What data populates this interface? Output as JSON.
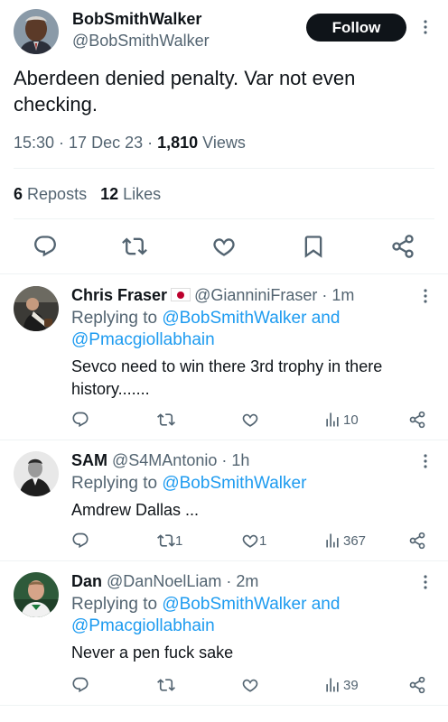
{
  "main_tweet": {
    "author_name": "BobSmithWalker",
    "author_handle": "@BobSmithWalker",
    "follow_label": "Follow",
    "text": "Aberdeen denied penalty. Var not even checking.",
    "time": "15:30",
    "date": "17 Dec 23",
    "views_count": "1,810",
    "views_label": "Views",
    "reposts_count": "6",
    "reposts_label": "Reposts",
    "likes_count": "12",
    "likes_label": "Likes"
  },
  "replies": [
    {
      "name": "Chris Fraser",
      "flag": "japan-flag",
      "handle": "@GianniniFraser",
      "age": "1m",
      "replying_prefix": "Replying to",
      "replying_line1": "@BobSmithWalker and",
      "replying_line2": "@Pmacgiollabhain",
      "text": "Sevco need to win there 3rd trophy in there history.......",
      "repost_count": "",
      "like_count": "",
      "views": "10"
    },
    {
      "name": "SAM",
      "handle": "@S4MAntonio",
      "age": "1h",
      "replying_prefix": "Replying to",
      "replying_line1": "@BobSmithWalker",
      "text": "Amdrew Dallas ...",
      "repost_count": "1",
      "like_count": "1",
      "views": "367"
    },
    {
      "name": "Dan",
      "handle": "@DanNoelLiam",
      "age": "2m",
      "replying_prefix": "Replying to",
      "replying_line1": "@BobSmithWalker and",
      "replying_line2": "@Pmacgiollabhain",
      "text": "Never a pen fuck sake",
      "repost_count": "",
      "like_count": "",
      "views": "39"
    }
  ],
  "colors": {
    "text": "#0f1419",
    "secondary": "#536471",
    "link": "#1d9bf0",
    "divider": "#eff3f4",
    "follow_bg": "#0f1419"
  }
}
